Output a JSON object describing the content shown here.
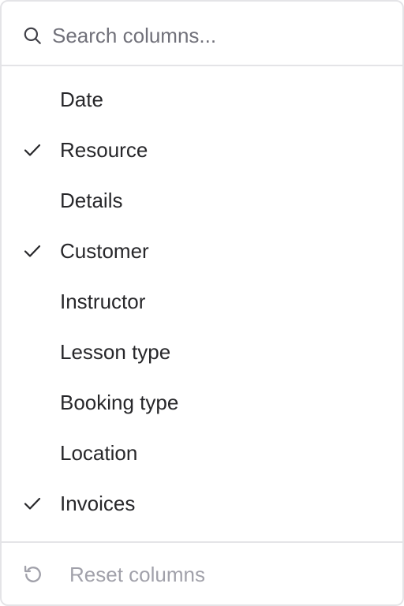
{
  "search": {
    "placeholder": "Search columns...",
    "value": "",
    "icon": "search-icon"
  },
  "columns": [
    {
      "label": "Date",
      "checked": false
    },
    {
      "label": "Resource",
      "checked": true
    },
    {
      "label": "Details",
      "checked": false
    },
    {
      "label": "Customer",
      "checked": true
    },
    {
      "label": "Instructor",
      "checked": false
    },
    {
      "label": "Lesson type",
      "checked": false
    },
    {
      "label": "Booking type",
      "checked": false
    },
    {
      "label": "Location",
      "checked": false
    },
    {
      "label": "Invoices",
      "checked": true
    }
  ],
  "footer": {
    "reset_label": "Reset columns",
    "icon": "reset-icon"
  },
  "colors": {
    "text": "#27272a",
    "muted": "#71717a",
    "disabled": "#a1a1aa",
    "border": "#e4e4e7"
  }
}
